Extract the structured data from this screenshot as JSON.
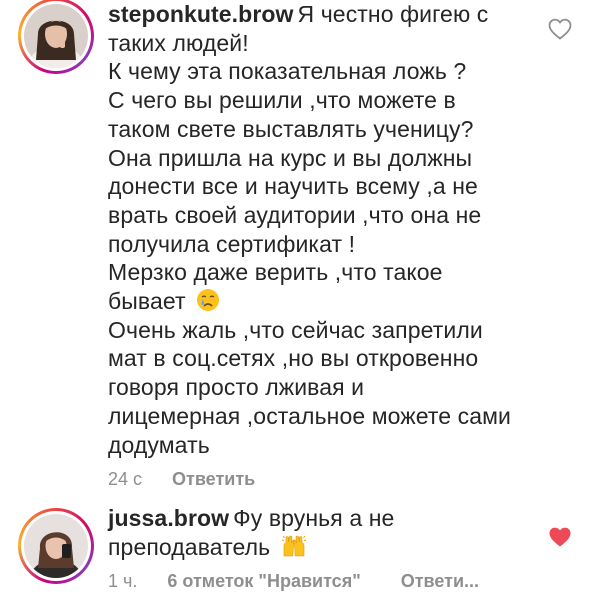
{
  "comments": [
    {
      "username": "steponkute.brow",
      "lines": [
        "Я честно фигею с",
        "таких людей!",
        "К чему эта показательная ложь ?",
        "С чего вы решили ,что можете в",
        "таком свете выставлять ученицу?",
        "Она пришла на курс и вы должны",
        "донести все и научить всему ,а не",
        "врать своей аудитории ,что она не",
        "получила сертификат !",
        "Мерзко даже верить ,что такое",
        "бывает",
        "Очень жаль ,что сейчас запретили",
        "мат в соц.сетях ,но вы откровенно",
        "говоря просто лживая и",
        "лицемерная ,остальное можете сами",
        "додумать"
      ],
      "emoji_icon": "crying-face-icon",
      "time": "24 с",
      "reply_label": "Ответить",
      "liked": false
    },
    {
      "username": "jussa.brow",
      "lines": [
        "Фу врунья а не",
        "преподаватель"
      ],
      "emoji_icon": "raising-hands-icon",
      "time": "1 ч.",
      "likes_label": "6 отметок \"Нравится\"",
      "reply_label": "Ответи...",
      "liked": true,
      "heart_color": "#ed4956"
    }
  ]
}
